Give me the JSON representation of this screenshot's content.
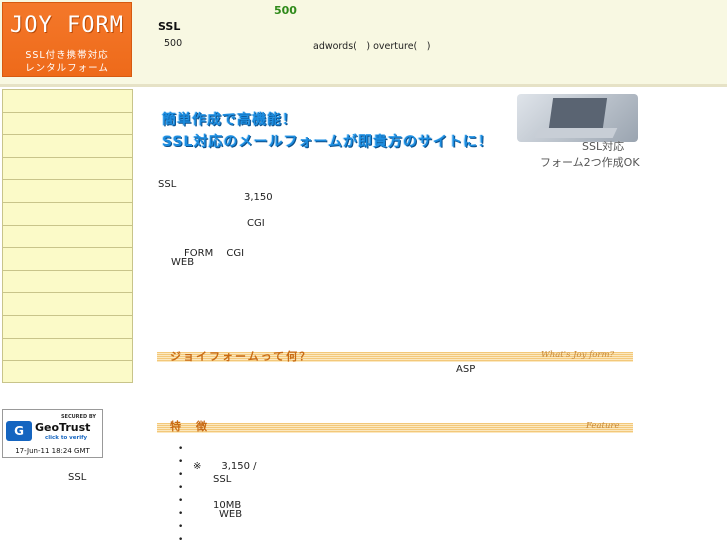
{
  "header": {
    "logo_title": "JOY FORM",
    "logo_sub1": "SSL付き携帯対応",
    "logo_sub2": "レンタルフォーム",
    "price": "500",
    "ssl": "SSL",
    "sub_price": "500",
    "ad_text": "adwords(　) overture(　)"
  },
  "sidebar": {
    "items": [
      "",
      "",
      "",
      "",
      "",
      "",
      "",
      "",
      "",
      "",
      "",
      "",
      ""
    ]
  },
  "badge": {
    "secured": "SECURED BY",
    "name": "GeoTrust",
    "click": "click to verify",
    "date": "17-Jun-11 18:24 GMT"
  },
  "sidebar_ssl": "SSL",
  "hero": {
    "line1": "簡単作成で高機能！",
    "line2": "SSL対応のメールフォームが即貴方のサイトに！",
    "cap1": "SSL対応",
    "cap2": "フォーム2つ作成OK"
  },
  "intro": {
    "ssl": "SSL",
    "price": "3,150",
    "cgi": "CGI",
    "form_cgi": "FORM　 CGI",
    "web": "WEB"
  },
  "section_what": {
    "title": "ジョイフォームって何？",
    "script": "What's Joy form?",
    "asp": "ASP"
  },
  "section_feature": {
    "title": "特　徴",
    "script": "Feature",
    "bullets": [
      "",
      "※　　3,150 /",
      "　　SSL",
      "",
      "　　10MB",
      "WEB",
      "",
      ""
    ]
  },
  "colors": {
    "logo_bg": "#f26f1f",
    "header_bg": "#f8f8e2",
    "nav_bg": "#fbfac8",
    "hero_blue": "#1c8de0",
    "section_orange": "#c86a14"
  }
}
